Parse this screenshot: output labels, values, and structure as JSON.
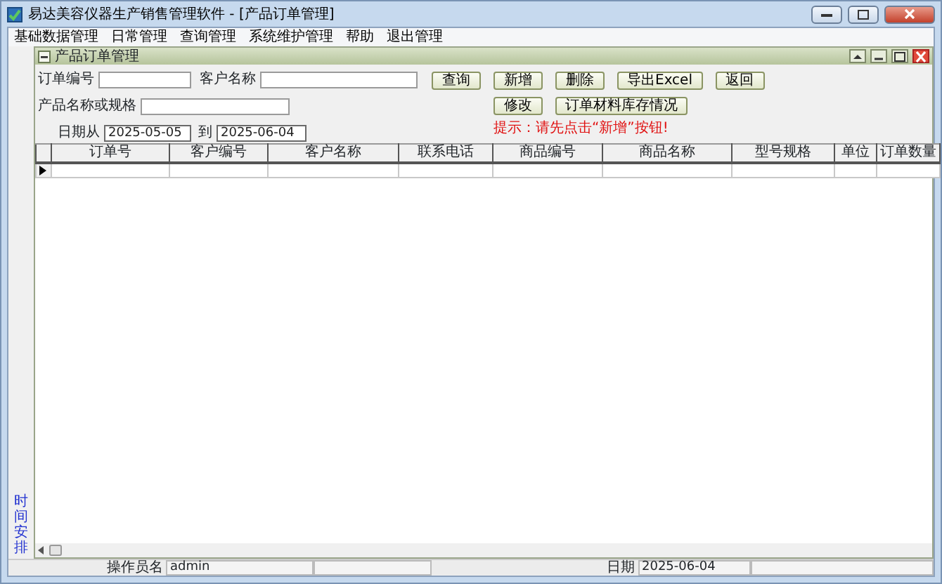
{
  "window": {
    "title": "易达美容仪器生产销售管理软件 - [产品订单管理]"
  },
  "menu": [
    "基础数据管理",
    "日常管理",
    "查询管理",
    "系统维护管理",
    "帮助",
    "退出管理"
  ],
  "child_window": {
    "title": "产品订单管理"
  },
  "fields": [
    {
      "label": "订单编号",
      "kind": "text"
    },
    {
      "label": "客户名称",
      "kind": "text"
    },
    {
      "label": "产品名称或规格",
      "kind": "text"
    },
    {
      "label": "日期从",
      "kind": "date",
      "value": "2025-05-05"
    },
    {
      "label": "到",
      "kind": "date",
      "value": "2025-06-04"
    }
  ],
  "buttons": [
    [
      "查询",
      "新增",
      "删除",
      "导出Excel",
      "返回"
    ],
    [
      "修改",
      "订单材料库存情况"
    ]
  ],
  "hint": "提示：请先点击“新增”按钮!",
  "table": {
    "columns": [
      "订单号",
      "客户编号",
      "客户名称",
      "联系电话",
      "商品编号",
      "商品名称",
      "型号规格",
      "单位",
      "订单数量"
    ]
  },
  "side_panel": {
    "label": "时间安排"
  },
  "status_bar": [
    {
      "label": "操作员名",
      "value": "admin"
    },
    {
      "label": "日期",
      "value": "2025-06-04"
    }
  ]
}
